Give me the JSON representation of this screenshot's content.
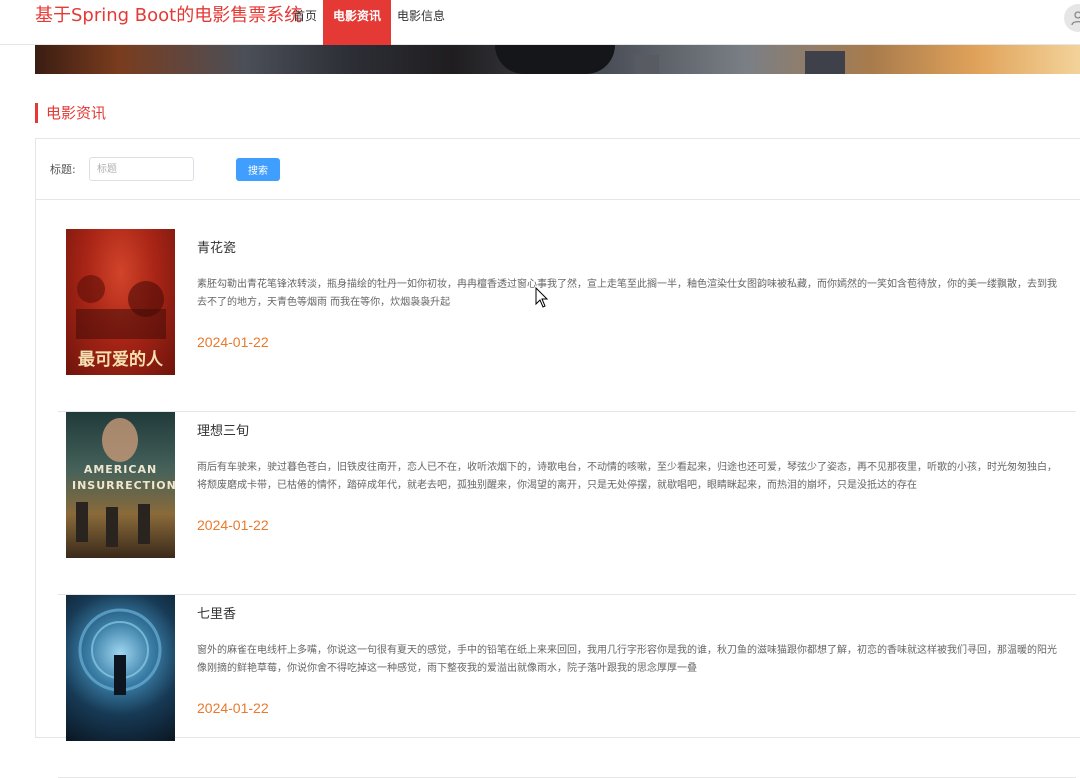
{
  "header": {
    "site_title": "基于Spring Boot的电影售票系统",
    "nav": [
      {
        "label": "首页",
        "active": false
      },
      {
        "label": "电影资讯",
        "active": true
      },
      {
        "label": "电影信息",
        "active": false
      }
    ],
    "avatar_icon": "user-icon"
  },
  "section": {
    "title": "电影资讯"
  },
  "search": {
    "label": "标题:",
    "placeholder": "标题",
    "value": "",
    "button_label": "搜索"
  },
  "colors": {
    "brand": "#e53935",
    "button": "#409eff",
    "date": "#e87a2d"
  },
  "news": [
    {
      "title": "青花瓷",
      "description": "素胚勾勒出青花笔锋浓转淡，瓶身描绘的牡丹一如你初妆，冉冉檀香透过窗心事我了然，宣上走笔至此搁一半，釉色渲染仕女图韵味被私藏，而你嫣然的一笑如含苞待放，你的美一缕飘散，去到我去不了的地方，天青色等烟雨 而我在等你，炊烟袅袅升起",
      "date": "2024-01-22",
      "poster_text": "最可爱的人"
    },
    {
      "title": "理想三旬",
      "description": "雨后有车驶来，驶过暮色苍白，旧铁皮往南开，恋人已不在，收听浓烟下的，诗歌电台，不动情的咳嗽，至少看起来，归途也还可爱，琴弦少了姿态，再不见那夜里，听歌的小孩，时光匆匆独白，将颓废磨成卡带，已枯倦的情怀，踏碎成年代，就老去吧，孤独别醒来，你渴望的离开，只是无处停摆，就歇唱吧，眼睛眯起来，而热泪的崩坏，只是没抵达的存在",
      "date": "2024-01-22",
      "poster_text": "AMERICAN INSURRECTION"
    },
    {
      "title": "七里香",
      "description": "窗外的麻雀在电线杆上多嘴，你说这一句很有夏天的感觉，手中的铅笔在纸上来来回回，我用几行字形容你是我的谁，秋刀鱼的滋味猫跟你都想了解，初恋的香味就这样被我们寻回，那温暖的阳光像刚摘的鲜艳草莓，你说你舍不得吃掉这一种感觉，雨下整夜我的爱溢出就像雨水，院子落叶跟我的思念厚厚一叠",
      "date": "2024-01-22",
      "poster_text": ""
    }
  ]
}
